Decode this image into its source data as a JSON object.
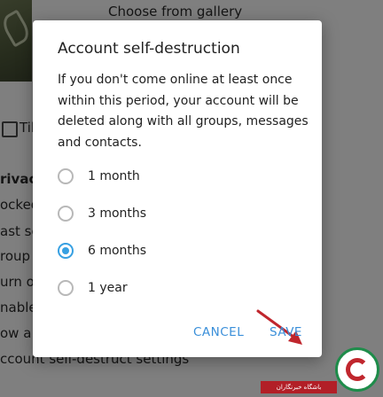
{
  "background": {
    "choose_gallery": "Choose from gallery",
    "tile_label": "Til",
    "privacy": "rivacy",
    "line1": "ocked",
    "line2": "ast se",
    "line3": "roup i",
    "line4": "urn on",
    "line5": "nable",
    "line6": "ow a",
    "account_destruct": "ccount self-destruct settings"
  },
  "dialog": {
    "title": "Account self-destruction",
    "description": "If you don't come online at least once within this period, your account will be deleted along with all groups, messages and contacts.",
    "options": [
      {
        "label": "1 month",
        "checked": false
      },
      {
        "label": "3 months",
        "checked": false
      },
      {
        "label": "6 months",
        "checked": true
      },
      {
        "label": "1 year",
        "checked": false
      }
    ],
    "cancel_label": "CANCEL",
    "save_label": "SAVE",
    "accent_color": "#37a0e2",
    "arrow_color": "#c0262d"
  },
  "watermark": {
    "text": "باشگاه خبرنگاران"
  }
}
